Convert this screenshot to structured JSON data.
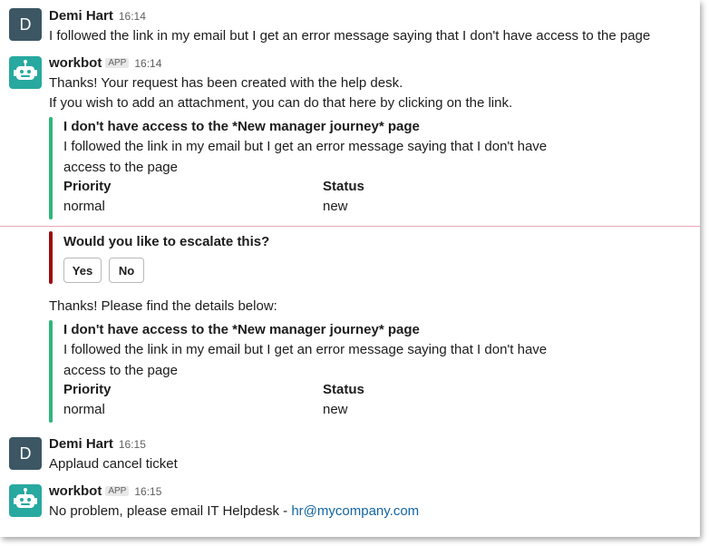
{
  "messages": {
    "m1": {
      "avatar_letter": "D",
      "author": "Demi Hart",
      "time": "16:14",
      "text": "I followed the link in my email but I get an error message saying that I don't have access to the page"
    },
    "m2": {
      "author": "workbot",
      "badge": "APP",
      "time": "16:14",
      "line1": "Thanks! Your request has been created with the help desk.",
      "line2": "If you wish to add an attachment, you can do that here by clicking on the link.",
      "attachment": {
        "title": "I don't have access to the *New manager journey* page",
        "text_line1": "I followed the link in my email but I get an error message saying that I don't have",
        "text_line2": "access to the page",
        "priority_label": "Priority",
        "priority_value": "normal",
        "status_label": "Status",
        "status_value": "new"
      }
    },
    "escalate": {
      "question": "Would you like to escalate this?",
      "yes_label": "Yes",
      "no_label": "No"
    },
    "m3": {
      "text": "Thanks! Please find the details below:",
      "attachment": {
        "title": "I don't have access to the *New manager journey* page",
        "text_line1": "I followed the link in my email but I get an error message saying that I don't have",
        "text_line2": "access to the page",
        "priority_label": "Priority",
        "priority_value": "normal",
        "status_label": "Status",
        "status_value": "new"
      }
    },
    "m4": {
      "avatar_letter": "D",
      "author": "Demi Hart",
      "time": "16:15",
      "text": "Applaud cancel ticket"
    },
    "m5": {
      "author": "workbot",
      "badge": "APP",
      "time": "16:15",
      "text_prefix": "No problem, please email IT Helpdesk - ",
      "email_link": "hr@mycompany.com"
    }
  },
  "colors": {
    "bot_avatar": "#27a9a0",
    "user_avatar": "#3c5664",
    "attachment_bar": "#2eb67d",
    "escalate_bar": "#9c0a0a",
    "link": "#1264a3",
    "new_divider": "#e8a8b8"
  },
  "icons": {
    "bot_avatar": "robot-icon"
  }
}
